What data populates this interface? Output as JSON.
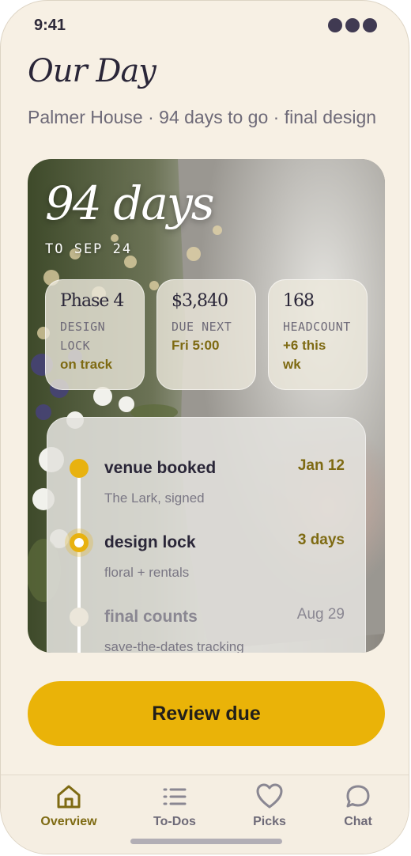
{
  "status": {
    "time": "9:41"
  },
  "header": {
    "title": "Our Day",
    "subtitle": "Palmer House · 94 days to go · final design"
  },
  "countdown": {
    "big": "94 days",
    "sub": "TO SEP 24"
  },
  "stats": [
    {
      "value": "Phase 4",
      "label_1": "DESIGN",
      "label_2": "LOCK",
      "status": "on track"
    },
    {
      "value": "$3,840",
      "label_1": "DUE NEXT",
      "status": "Fri 5:00"
    },
    {
      "value": "168",
      "label_1": "HEADCOUNT",
      "status_1": "+6 this",
      "status_2": "wk"
    }
  ],
  "timeline": [
    {
      "title": "venue booked",
      "detail": "The Lark, signed",
      "date": "Jan 12",
      "state": "done"
    },
    {
      "title": "design lock",
      "detail": "floral + rentals",
      "date": "3 days",
      "state": "current"
    },
    {
      "title": "final counts",
      "detail": "save-the-dates tracking",
      "date": "Aug 29",
      "state": "pending"
    }
  ],
  "cta": {
    "label": "Review due"
  },
  "tabs": [
    {
      "label": "Overview",
      "icon": "home-icon",
      "active": true
    },
    {
      "label": "To-Dos",
      "icon": "list-icon",
      "active": false
    },
    {
      "label": "Picks",
      "icon": "heart-icon",
      "active": false
    },
    {
      "label": "Chat",
      "icon": "chat-bubble-icon",
      "active": false
    }
  ],
  "colors": {
    "accent": "#eab308",
    "accent_text": "#7e6a12",
    "background": "#f7f0e4",
    "ink": "#2a2638"
  }
}
